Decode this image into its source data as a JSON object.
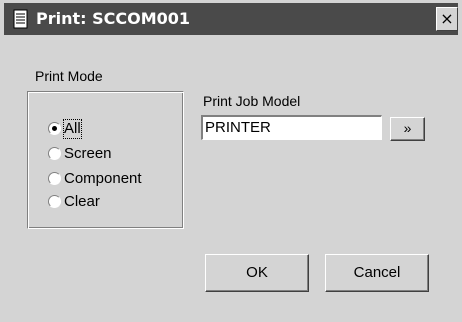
{
  "window": {
    "title": "Print: SCCOM001",
    "close_label": "×",
    "icon": "printer-document-icon"
  },
  "print_mode": {
    "label": "Print Mode",
    "options": [
      {
        "label": "All",
        "selected": true
      },
      {
        "label": "Screen",
        "selected": false
      },
      {
        "label": "Component",
        "selected": false
      },
      {
        "label": "Clear",
        "selected": false
      }
    ]
  },
  "print_job_model": {
    "label": "Print Job Model",
    "value": "PRINTER",
    "browse_label": "»"
  },
  "buttons": {
    "ok": "OK",
    "cancel": "Cancel"
  },
  "colors": {
    "titlebar": "#4a4a4a",
    "dialog": "#d4d4d4"
  }
}
